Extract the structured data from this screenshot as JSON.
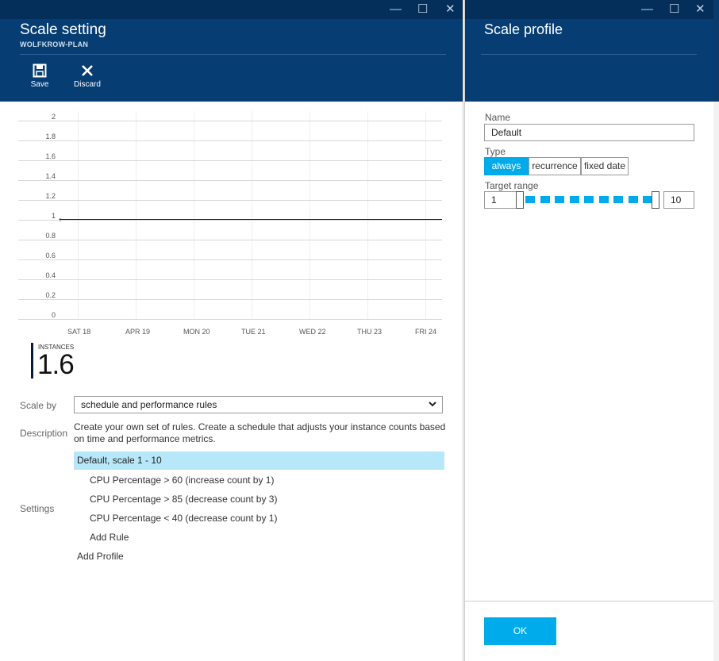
{
  "left_blade": {
    "title": "Scale setting",
    "subtitle": "WOLFKROW-PLAN",
    "window_controls": {
      "minimize": "—",
      "maximize": "☐",
      "close": "✕"
    },
    "commands": [
      {
        "label": "Save",
        "icon": "save-icon"
      },
      {
        "label": "Discard",
        "icon": "close-icon"
      }
    ],
    "chart": {
      "y_ticks": [
        "2",
        "1.8",
        "1.6",
        "1.4",
        "1.2",
        "1",
        "0.8",
        "0.6",
        "0.4",
        "0.2",
        "0"
      ],
      "x_ticks": [
        "SAT 18",
        "APR 19",
        "MON 20",
        "TUE 21",
        "WED 22",
        "THU 23",
        "FRI 24"
      ]
    },
    "kpi": {
      "label": "INSTANCES",
      "value": "1.6"
    },
    "scale_by": {
      "label": "Scale by",
      "value": "schedule and performance rules"
    },
    "description": {
      "label": "Description",
      "text": "Create your own set of rules. Create a schedule that adjusts your instance counts based on time and performance metrics."
    },
    "settings": {
      "label": "Settings",
      "profile": "Default, scale 1 - 10",
      "rules": [
        "CPU Percentage > 60 (increase count by 1)",
        "CPU Percentage > 85 (decrease count by 3)",
        "CPU Percentage < 40 (decrease count by 1)"
      ],
      "add_rule": "Add Rule",
      "add_profile": "Add Profile"
    }
  },
  "right_blade": {
    "title": "Scale profile",
    "window_controls": {
      "minimize": "—",
      "maximize": "☐",
      "close": "✕"
    },
    "name_label": "Name",
    "name_value": "Default",
    "type_label": "Type",
    "type_options": [
      "always",
      "recurrence",
      "fixed date"
    ],
    "type_selected": "always",
    "target_label": "Target range",
    "range_min": "1",
    "range_max": "10",
    "ok_label": "OK"
  },
  "chart_data": {
    "type": "line",
    "x": [
      "SAT 18",
      "APR 19",
      "MON 20",
      "TUE 21",
      "WED 22",
      "THU 23",
      "FRI 24"
    ],
    "series": [
      {
        "values": [
          1,
          1,
          1,
          1,
          1,
          1,
          1
        ]
      }
    ],
    "ylim": [
      0,
      2
    ],
    "grid": true
  },
  "colors": {
    "header": "#063d73",
    "accent": "#00abec",
    "selection": "#b7e8fa",
    "line": "#0a1a5a"
  }
}
